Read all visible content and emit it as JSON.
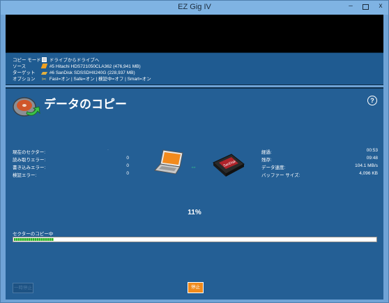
{
  "window": {
    "title": "EZ Gig IV",
    "minimize_label": "–",
    "close_label": "x"
  },
  "info": {
    "copy_mode": {
      "key": "コピー モード",
      "value": "ドライブからドライブへ"
    },
    "source": {
      "key": "ソース",
      "value": "#5 Hitachi HDS721050CLA362 (476,941 MB)"
    },
    "target": {
      "key": "ターゲット",
      "value": "#6 SanDisk SDSSDHII240G (228,937 MB)"
    },
    "options": {
      "key": "オプション",
      "value": "Fast=オン  |  Safe=オン  |  検証中=オフ  |  Smart=オン"
    }
  },
  "main": {
    "heading": "データのコピー",
    "help": "?",
    "left_stats": [
      {
        "label": "現在のセクター:",
        "value": "·"
      },
      {
        "label": "読み取りエラー:",
        "value": "0"
      },
      {
        "label": "書き込みエラー:",
        "value": "0"
      },
      {
        "label": "検証エラー:",
        "value": "0"
      }
    ],
    "right_stats": [
      {
        "label": "経過:",
        "value": "00:53"
      },
      {
        "label": "残存:",
        "value": "09:48"
      },
      {
        "label": "データ速度:",
        "value": "104.1 MB/s"
      },
      {
        "label": "バッファー サイズ:",
        "value": "4,096 KB"
      }
    ],
    "percent": "11%",
    "progress_fraction": 0.11,
    "progress_label": "セクターのコピー中",
    "ghost_button": "一時停止",
    "stop_button": "停止",
    "ssd_brand": "SanDisk"
  }
}
